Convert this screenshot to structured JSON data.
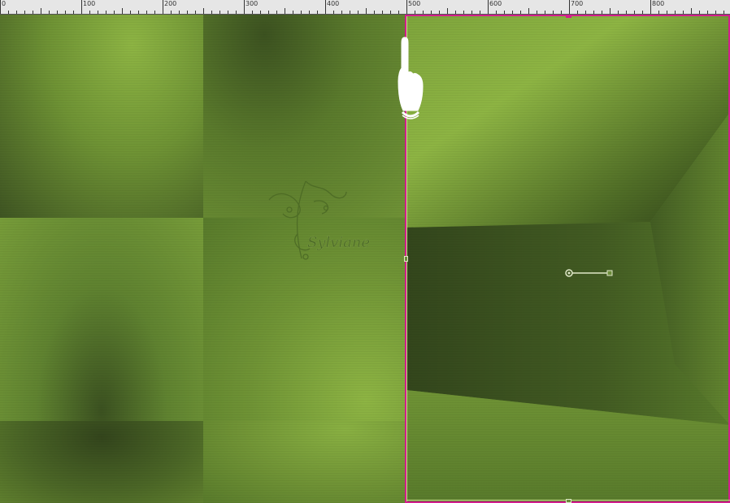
{
  "ruler": {
    "labels": [
      "0",
      "100",
      "200",
      "300",
      "400",
      "500",
      "600",
      "700",
      "800"
    ]
  },
  "watermark": {
    "text": "Sylviane"
  },
  "icons": {
    "hand_tool": "hand-pointer-icon",
    "rotation_handle": "rotation-handle-icon"
  },
  "colors": {
    "light_green": "#8db443",
    "dark_green": "#33451c",
    "guide_magenta": "#d21d8c",
    "selection_line": "#c8e08a",
    "ruler_bg": "#e6e6e6"
  }
}
